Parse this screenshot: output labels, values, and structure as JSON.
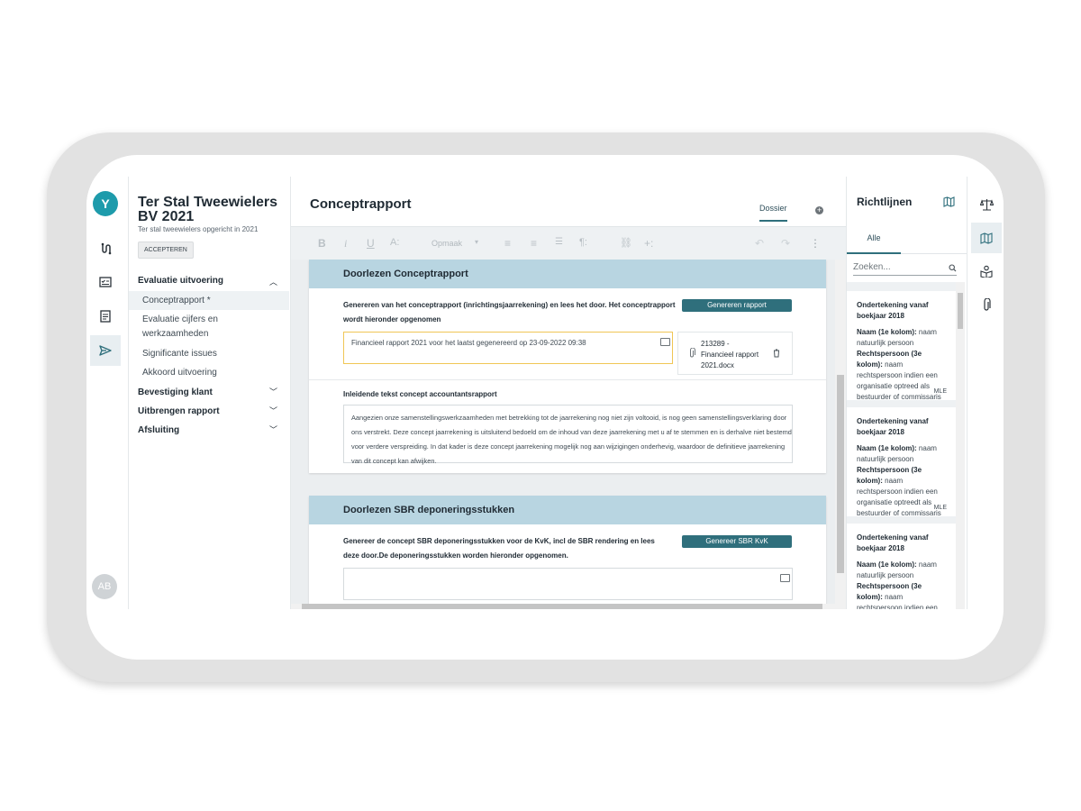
{
  "client": {
    "logo_letter": "Y",
    "title": "Ter Stal Tweewielers BV 2021",
    "subtitle": "Ter stal tweewielers opgericht in 2021",
    "accept_label": "ACCEPTEREN",
    "avatar_initials": "AB"
  },
  "nav": {
    "sections": [
      {
        "label": "Evaluatie uitvoering",
        "expanded": true,
        "items": [
          "Conceptrapport *",
          "Evaluatie cijfers en werkzaamheden",
          "Significante issues",
          "Akkoord uitvoering"
        ]
      },
      {
        "label": "Bevestiging klant",
        "expanded": false
      },
      {
        "label": "Uitbrengen rapport",
        "expanded": false
      },
      {
        "label": "Afsluiting",
        "expanded": false
      }
    ]
  },
  "main": {
    "title": "Conceptrapport",
    "tab_dossier": "Dossier",
    "toolbar": {
      "bold": "B",
      "italic": "i",
      "underline": "U",
      "font_size": "A:",
      "format_dropdown": "Opmaak",
      "chevron": "▾",
      "align_left": "≡",
      "align_center": "≡",
      "list": "☰",
      "paragraph": "¶:",
      "link": "⛓",
      "insert": "+:",
      "undo": "↶",
      "redo": "↷",
      "more": "⋮"
    },
    "cards": [
      {
        "header": "Doorlezen Conceptrapport",
        "description": "Genereren van het conceptrapport (inrichtingsjaarrekening) en lees het door. Het conceptrapport wordt hieronder opgenomen",
        "button": "Genereren rapport",
        "status_text": "Financieel rapport 2021 voor het laatst gegenereerd op 23-09-2022 09:38",
        "file_name": "213289 - Financieel rapport 2021.docx",
        "intro_label": "Inleidende tekst concept accountantsrapport",
        "intro_text": "Aangezien onze samenstellingswerkzaamheden met betrekking tot de jaarrekening nog niet zijn voltooid, is nog geen samenstellingsverklaring door ons verstrekt. Deze concept jaarrekening is uitsluitend bedoeld om de inhoud van deze jaarrekening met u af te stemmen en is derhalve niet bestemd voor verdere verspreiding. In dat kader is deze concept jaarrekening mogelijk nog aan wijzigingen onderhevig, waardoor de definitieve jaarrekening van dit concept kan afwijken."
      },
      {
        "header": "Doorlezen SBR deponeringsstukken",
        "description": "Genereer de concept SBR deponeringsstukken voor de KvK, incl de SBR rendering en lees deze door.De deponeringsstukken worden hieronder opgenomen.",
        "button": "Genereer SBR KvK"
      }
    ]
  },
  "guidelines": {
    "title": "Richtlijnen",
    "tab_all": "Alle",
    "search_placeholder": "Zoeken...",
    "items": [
      {
        "title": "Ondertekening vanaf boekjaar 2018",
        "label1": "Naam (1e kolom):",
        "text1": "naam natuurlijk persoon",
        "label2": "Rechtspersoon (3e kolom):",
        "text2": "naam rechtspersoon indien een organisatie optreed als bestuurder of commissaris",
        "tag": "MLE"
      },
      {
        "title": "Ondertekening vanaf boekjaar 2018",
        "label1": "Naam (1e kolom):",
        "text1": "naam natuurlijk persoon",
        "label2": "Rechtspersoon (3e kolom):",
        "text2": "naam rechtspersoon indien een organisatie optreedt als bestuurder of commissaris",
        "tag": "MLE"
      },
      {
        "title": "Ondertekening vanaf boekjaar 2018",
        "label1": "Naam (1e kolom):",
        "text1": "naam natuurlijk persoon",
        "label2": "Rechtspersoon (3e kolom):",
        "text2": "naam rechtspersoon indien een organisatie optreedt als bestuurder of commissaris",
        "tag": ""
      }
    ]
  },
  "colors": {
    "accent": "#2f6f7c",
    "logo": "#1e9bab",
    "card_header": "#b8d5e1",
    "highlight_border": "#f0c655"
  },
  "icons": {
    "left_rail": [
      "workflow-icon",
      "checklist-icon",
      "document-icon",
      "send-icon"
    ],
    "right_rail": [
      "scale-icon",
      "map-icon",
      "book-user-icon",
      "paperclip-icon"
    ]
  }
}
